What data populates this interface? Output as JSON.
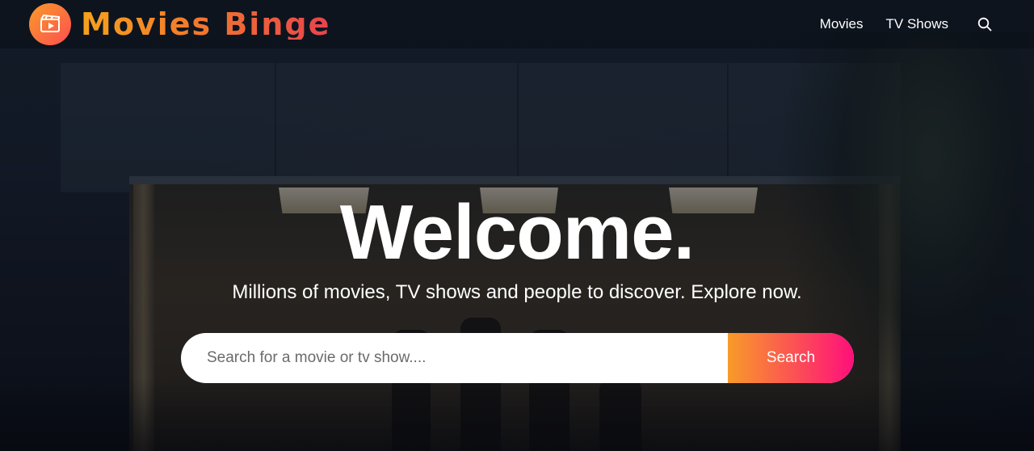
{
  "header": {
    "logo_text": "Movies Binge",
    "logo_icon": "clapperboard-play-icon",
    "nav": [
      {
        "label": "Movies"
      },
      {
        "label": "TV Shows"
      }
    ],
    "search_icon": "search-icon"
  },
  "hero": {
    "title": "Welcome.",
    "subtitle": "Millions of movies, TV shows and people to discover. Explore now.",
    "search": {
      "placeholder": "Search for a movie or tv show....",
      "value": "",
      "button_label": "Search"
    }
  },
  "colors": {
    "accent_start": "#f89b29",
    "accent_end": "#ff0f7b"
  }
}
